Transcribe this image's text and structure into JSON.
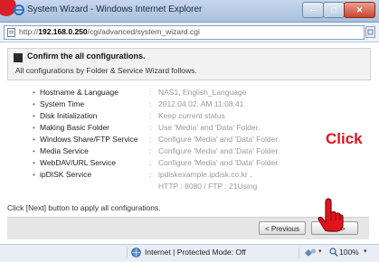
{
  "window": {
    "title": "System Wizard - Windows Internet Explorer",
    "minimize_glyph": "–",
    "maximize_glyph": "□",
    "close_glyph": "✕"
  },
  "address_bar": {
    "url_prefix": "http://",
    "url_host": "192.168.0.250",
    "url_path": "/cgi/advanced/system_wizard.cgi"
  },
  "wizard": {
    "title": "Confirm the all configurations.",
    "subtitle": "All configurations by Folder & Service Wizard follows.",
    "items": [
      {
        "label": "Hostname & Language",
        "value": "NAS1, English_Language"
      },
      {
        "label": "System Time",
        "value": "2012.04.02. AM 11:08:41"
      },
      {
        "label": "Disk Initialization",
        "value": "Keep current status"
      },
      {
        "label": "Making Basic Folder",
        "value": "Use 'Media' and 'Data' Folder."
      },
      {
        "label": "Windows Share/FTP Service",
        "value": "Configure 'Media' and 'Data' Folder."
      },
      {
        "label": "Media Service",
        "value": "Configure 'Media' and 'Data' Folder."
      },
      {
        "label": "WebDAV/URL Service",
        "value": "Configure 'Media' and 'Data' Folder."
      },
      {
        "label": "ipDISK Service",
        "value": "ipdiskexample.ipdisk.co.kr ,",
        "value2": "HTTP : 8080 / FTP : 21Using"
      }
    ],
    "bullet": "•",
    "colon": ":",
    "apply_text": "Click [Next] button to apply all configurations.",
    "prev_label": "< Previous",
    "next_label": "Next >"
  },
  "annotation": {
    "click_label": "Click",
    "color": "#e0141e"
  },
  "status_bar": {
    "zone_text": "Internet | Protected Mode: Off",
    "dropdown_glyph": "▾",
    "zoom": "100%"
  }
}
